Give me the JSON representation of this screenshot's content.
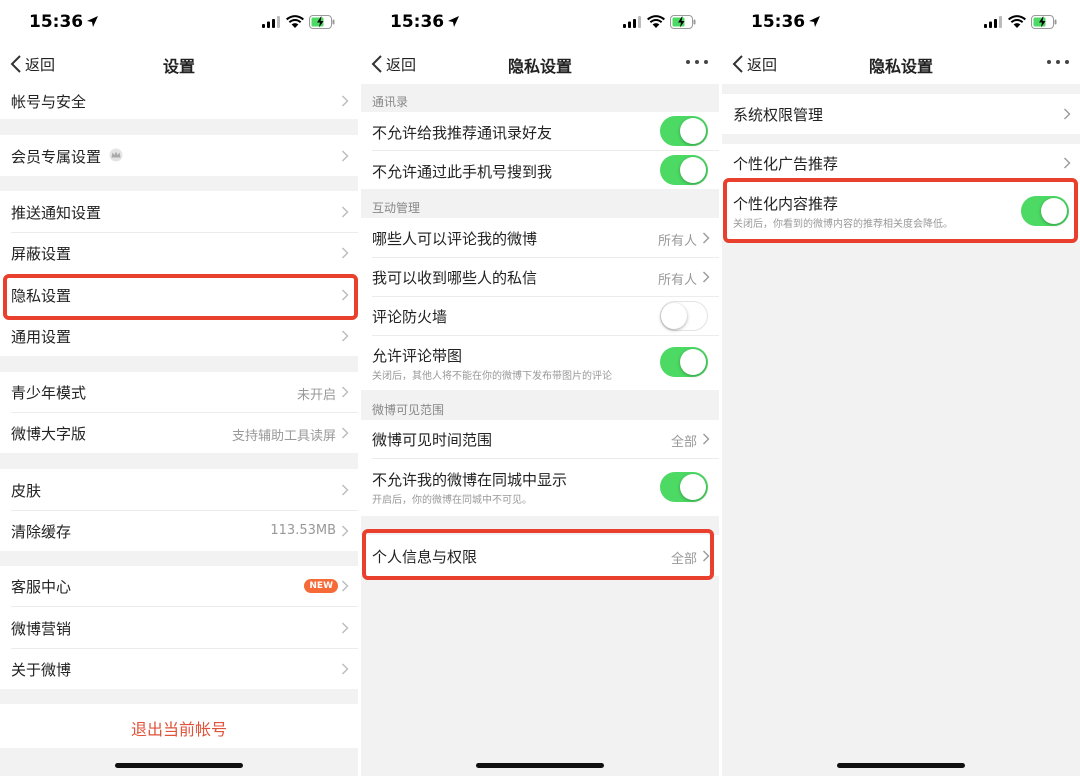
{
  "status_time": "15:36",
  "panel1": {
    "back": "返回",
    "title": "设置",
    "items": {
      "account": "帐号与安全",
      "vip": "会员专属设置",
      "push": "推送通知设置",
      "block": "屏蔽设置",
      "privacy": "隐私设置",
      "general": "通用设置",
      "teen": "青少年模式",
      "teen_value": "未开启",
      "bigfont": "微博大字版",
      "bigfont_value": "支持辅助工具读屏",
      "skin": "皮肤",
      "cache": "清除缓存",
      "cache_value": "113.53MB",
      "service": "客服中心",
      "service_badge": "NEW",
      "marketing": "微博营销",
      "about": "关于微博"
    },
    "logout": "退出当前帐号"
  },
  "panel2": {
    "back": "返回",
    "title": "隐私设置",
    "sections": {
      "contacts": "通讯录",
      "interaction": "互动管理",
      "visibility": "微博可见范围"
    },
    "items": {
      "no_recommend_contacts": "不允许给我推荐通讯录好友",
      "no_phone_search": "不允许通过此手机号搜到我",
      "who_comment": "哪些人可以评论我的微博",
      "who_comment_value": "所有人",
      "who_message": "我可以收到哪些人的私信",
      "who_message_value": "所有人",
      "firewall": "评论防火墙",
      "comment_images": "允许评论带图",
      "comment_images_sub": "关闭后，其他人将不能在你的微博下发布带图片的评论",
      "visible_time": "微博可见时间范围",
      "visible_time_value": "全部",
      "no_local": "不允许我的微博在同城中显示",
      "no_local_sub": "开启后，你的微博在同城中不可见。",
      "personal_info": "个人信息与权限",
      "personal_info_value": "全部"
    },
    "toggles": {
      "no_recommend_contacts": true,
      "no_phone_search": true,
      "firewall": false,
      "comment_images": true,
      "no_local": true
    }
  },
  "panel3": {
    "back": "返回",
    "title": "隐私设置",
    "items": {
      "sys_perm": "系统权限管理",
      "ad": "个性化广告推荐",
      "content": "个性化内容推荐",
      "content_sub": "关闭后，你看到的微博内容的推荐相关度会降低。"
    },
    "toggles": {
      "content": true
    }
  },
  "colors": {
    "toggle_on": "#4cd964",
    "highlight": "#e8402c",
    "logout_text": "#e0533b",
    "badge": "#f56a36",
    "background": "#f2f2f2"
  }
}
